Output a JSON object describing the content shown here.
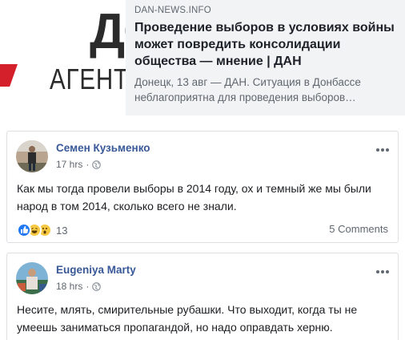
{
  "link_preview": {
    "domain": "DAN-NEWS.INFO",
    "title": "Проведение выборов в условиях войны может повредить консолидации общества — мнение | ДАН",
    "description": "Донецк, 13 авг — ДАН. Ситуация в Донбассе неблагоприятна для проведения выборов…",
    "thumbnail_text_large": "ДО",
    "thumbnail_text_small": "АГЕНТ"
  },
  "comments": [
    {
      "author": "Семен Кузьменко",
      "time": "17 hrs",
      "privacy_icon": "globe-icon",
      "text": "Как мы тогда провели выборы в 2014 году, ох и темный же мы были народ в том 2014, сколько всего не знали.",
      "reaction_count": "13",
      "reaction_icons": [
        "like-icon",
        "haha-icon",
        "wow-icon"
      ],
      "comments_label": "5 Comments"
    },
    {
      "author": "Eugeniya Marty",
      "time": "18 hrs",
      "privacy_icon": "globe-icon",
      "text": "Несите, млять, смирительные рубашки. Что выходит, когда ты не умеешь заниматься пропагандой, но надо оправдать херню."
    }
  ],
  "colors": {
    "author_link": "#385898",
    "meta_gray": "#606770",
    "like_blue": "#2078f4",
    "emoji_yellow": "#f7c844"
  }
}
